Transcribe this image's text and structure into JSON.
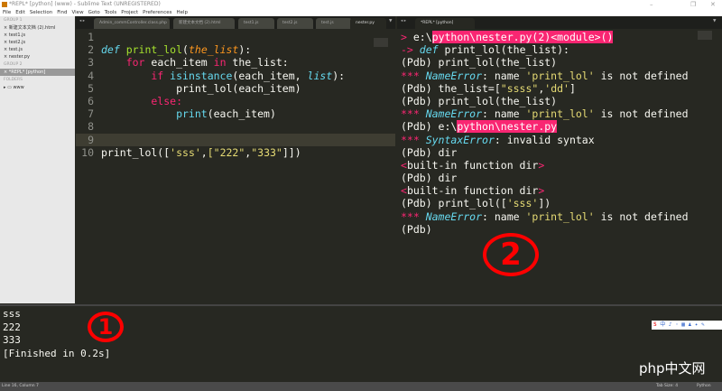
{
  "window": {
    "title": "*REPL* [python] (www) - Sublime Text (UNREGISTERED)"
  },
  "menu": [
    "File",
    "Edit",
    "Selection",
    "Find",
    "View",
    "Goto",
    "Tools",
    "Project",
    "Preferences",
    "Help"
  ],
  "sidebar": {
    "group1_label": "GROUP 1",
    "group1": [
      "新建文本文档 (2).html",
      "test1.js",
      "test2.js",
      "test.js",
      "nester.py"
    ],
    "group2_label": "GROUP 2",
    "group2": [
      "*REPL* [python]"
    ],
    "folders_label": "FOLDERS",
    "folder": "www"
  },
  "left_tabs": [
    "Admin_commController.class.php",
    "新建文本文档 (2).html",
    "test1.js",
    "test2.js",
    "test.js",
    "nester.py"
  ],
  "right_tabs": [
    "*REPL* [python]"
  ],
  "code_lines": [
    "1",
    "2",
    "3",
    "4",
    "5",
    "6",
    "7",
    "8",
    "9",
    "10"
  ],
  "code": {
    "l2a": "def",
    "l2b": " print_lol",
    "l2c": "(",
    "l2d": "the_list",
    "l2e": "):",
    "l3a": "    for",
    "l3b": " each_item ",
    "l3c": "in",
    "l3d": " the_list:",
    "l4a": "        if",
    "l4b": " isinstance",
    "l4c": "(each_item, ",
    "l4d": "list",
    "l4e": "):",
    "l5": "            print_lol(each_item)",
    "l6": "        else:",
    "l7a": "            print",
    "l7b": "(each_item)",
    "l10a": "print_lol([",
    "l10b": "'sss'",
    ",": ",",
    "l10c": "[\"222\"",
    "l10d": ",",
    "l10e": "\"333\"",
    "l10f": "]])"
  },
  "repl": {
    "r1a": "> ",
    "r1b": "e:\\",
    "r1c": "python\\nester.py(2)<module>()",
    "r2a": "-> ",
    "r2b": "def",
    "r2c": " print_lol(the_list):",
    "r3": "(Pdb) print_lol(the_list)",
    "r4a": "*** ",
    "r4b": "NameError",
    "r4c": ": name ",
    "r4d": "'print_lol'",
    "r4e": " is not defined",
    "r5a": "(Pdb) the_list=[",
    "r5b": "\"ssss\"",
    "r5c": ",",
    "r5d": "'dd'",
    "r5e": "]",
    "r6": "(Pdb) print_lol(the_list)",
    "r8a": "(Pdb) e:\\",
    "r8b": "python\\nester.py",
    "r9b": "SyntaxError",
    "r9c": ": invalid syntax",
    "r10": "(Pdb) dir",
    "r11a": "<",
    "r11b": "built-in function dir",
    "r11c": ">",
    "r14a": "(Pdb) print_lol([",
    "r14b": "'sss'",
    "r14c": "])",
    "r16": "(Pdb)"
  },
  "output": [
    "sss",
    "222",
    "333",
    "[Finished in 0.2s]"
  ],
  "annotations": {
    "one": "1",
    "two": "2"
  },
  "status": {
    "left": "Line 16, Column 7",
    "tab_size": "Tab Size: 4",
    "syntax": "Python"
  },
  "watermark": "php中文网"
}
